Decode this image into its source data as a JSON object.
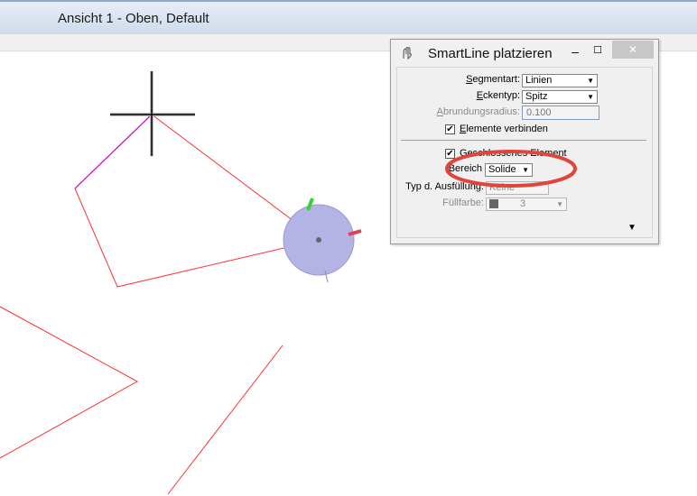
{
  "window": {
    "title": "Ansicht 1 - Oben, Default"
  },
  "dialog": {
    "title": "SmartLine platzieren",
    "minimize_label": "–",
    "maximize_label": "☐",
    "close_label": "✕",
    "segmentart": {
      "label_u": "S",
      "label_rest": "egmentart:",
      "value": "Linien"
    },
    "eckentyp": {
      "label_u": "E",
      "label_rest": "ckentyp:",
      "value": "Spitz"
    },
    "abrundungsradius": {
      "label_u": "A",
      "label_rest": "brundungsradius:",
      "value": "0.100"
    },
    "elemente_verbinden": {
      "label_u": "E",
      "label_rest": "lemente verbinden",
      "checked": true
    },
    "geschlossenes_element": {
      "label": "Geschlossenes Element",
      "checked": true
    },
    "bereich": {
      "label": "Bereich",
      "value": "Solide"
    },
    "typ_ausfuellung": {
      "label": "Typ d. Ausfüllung:",
      "value": "Keine"
    },
    "fuellfarbe": {
      "label": "Füllfarbe:",
      "value": "3",
      "swatch_color": "#666666"
    },
    "expand_icon": "expand-arrow-icon"
  },
  "colors": {
    "element_line": "#ff3030",
    "active_segment": "#d400d4",
    "highlight_ellipse": "#e0453c",
    "compass_fill": "#b3b3e6"
  }
}
